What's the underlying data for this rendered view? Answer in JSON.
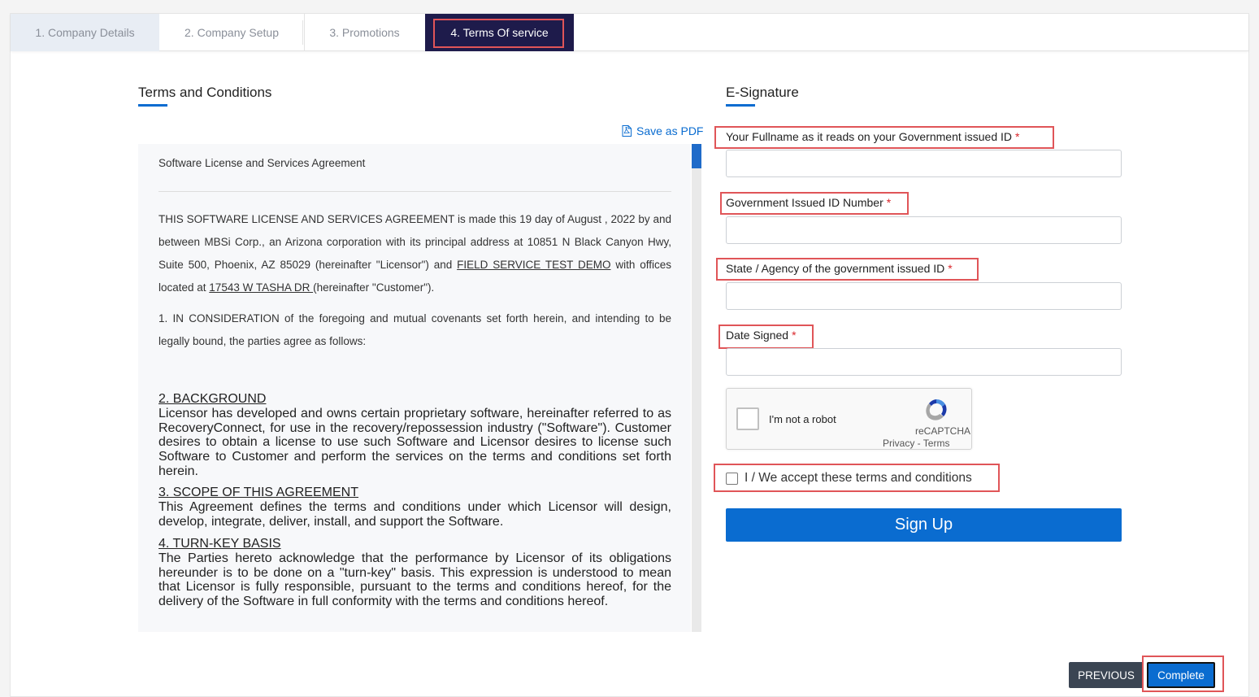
{
  "tabs": [
    {
      "label": "1.  Company Details"
    },
    {
      "label": "2.  Company Setup"
    },
    {
      "label": "3.  Promotions"
    },
    {
      "label": "4.  Terms Of service"
    }
  ],
  "terms": {
    "title": "Terms and Conditions",
    "save_pdf": "Save as PDF",
    "agreement_title": "Software License and Services Agreement",
    "intro_a": "THIS SOFTWARE LICENSE AND SERVICES AGREEMENT is made this 19 day of August , 2022 by and between MBSi Corp., an Arizona corporation with its principal address at 10851 N Black Canyon Hwy, Suite 500, Phoenix, AZ 85029 (hereinafter \"Licensor\") and ",
    "customer_name": "FIELD SERVICE TEST DEMO",
    "intro_b": " with offices located at ",
    "customer_address": "17543 W TASHA DR ",
    "intro_c": "(hereinafter \"Customer\").",
    "consideration": "1. IN CONSIDERATION of the foregoing and mutual covenants set forth herein, and intending to be legally bound, the parties agree as follows:",
    "sections": [
      {
        "heading": "2. BACKGROUND",
        "body": "Licensor has developed and owns certain proprietary software, hereinafter referred to as RecoveryConnect, for use in the recovery/repossession industry (\"Software\"). Customer desires to obtain a license to use such Software and Licensor desires to license such Software to Customer and perform the services on the terms and conditions set forth herein."
      },
      {
        "heading": "3. SCOPE OF THIS AGREEMENT",
        "body": "This Agreement defines the terms and conditions under which Licensor will design, develop, integrate, deliver, install, and support the Software."
      },
      {
        "heading": "4. TURN-KEY BASIS",
        "body": "The Parties hereto acknowledge that the performance by Licensor of its obligations hereunder is to be done on a \"turn-key\" basis. This expression is understood to mean that Licensor is fully responsible, pursuant to the terms and conditions hereof, for the delivery of the Software in full conformity with the terms and conditions hereof."
      }
    ]
  },
  "signature": {
    "title": "E-Signature",
    "fields": [
      {
        "label": "Your Fullname as it reads on your Government issued ID",
        "value": ""
      },
      {
        "label": "Government Issued ID Number",
        "value": ""
      },
      {
        "label": "State / Agency of the government issued ID",
        "value": ""
      },
      {
        "label": "Date Signed",
        "value": ""
      }
    ],
    "required_mark": "*",
    "captcha": {
      "text": "I'm not a robot",
      "brand": "reCAPTCHA",
      "links": "Privacy - Terms"
    },
    "accept_label": "I / We accept these terms and conditions",
    "signup_label": "Sign Up"
  },
  "footer": {
    "previous_label": "PREVIOUS",
    "complete_label": "Complete"
  },
  "colors": {
    "accent": "#0a6cd0",
    "active_tab": "#1e1b4b",
    "highlight": "#e05558",
    "required": "#d9262b"
  }
}
